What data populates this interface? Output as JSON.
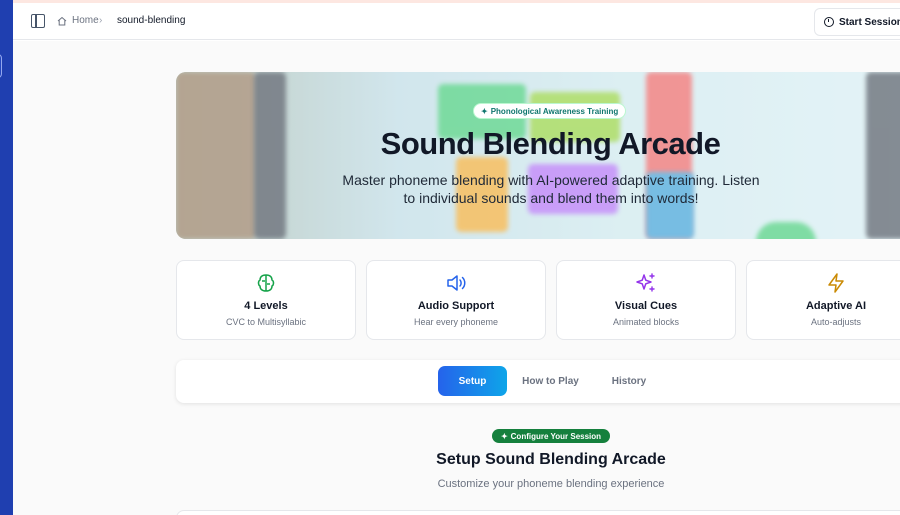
{
  "breadcrumb": {
    "home": "Home",
    "separator": "›",
    "current": "sound-blending"
  },
  "header": {
    "start_session": "Start Session"
  },
  "hero": {
    "badge": "Phonological Awareness Training",
    "title": "Sound Blending Arcade",
    "subtitle": "Master phoneme blending with AI-powered adaptive training. Listen to individual sounds and blend them into words!"
  },
  "features": [
    {
      "title": "4 Levels",
      "subtitle": "CVC to Multisyllabic",
      "icon": "brain-icon",
      "color": "#16a34a"
    },
    {
      "title": "Audio Support",
      "subtitle": "Hear every phoneme",
      "icon": "speaker-icon",
      "color": "#2563eb"
    },
    {
      "title": "Visual Cues",
      "subtitle": "Animated blocks",
      "icon": "sparkles-icon",
      "color": "#9333ea"
    },
    {
      "title": "Adaptive AI",
      "subtitle": "Auto-adjusts",
      "icon": "lightning-icon",
      "color": "#ca8a04"
    }
  ],
  "tabs": [
    {
      "label": "Setup",
      "active": true
    },
    {
      "label": "How to Play",
      "active": false
    },
    {
      "label": "History",
      "active": false
    }
  ],
  "setup": {
    "badge": "Configure Your Session",
    "title": "Setup Sound Blending Arcade",
    "subtitle": "Customize your phoneme blending experience"
  },
  "colors": {
    "sidebar": "#1f3fb0",
    "accent_gradient_start": "#2563eb",
    "accent_gradient_end": "#0ea5e9",
    "badge_green": "#15803d"
  }
}
